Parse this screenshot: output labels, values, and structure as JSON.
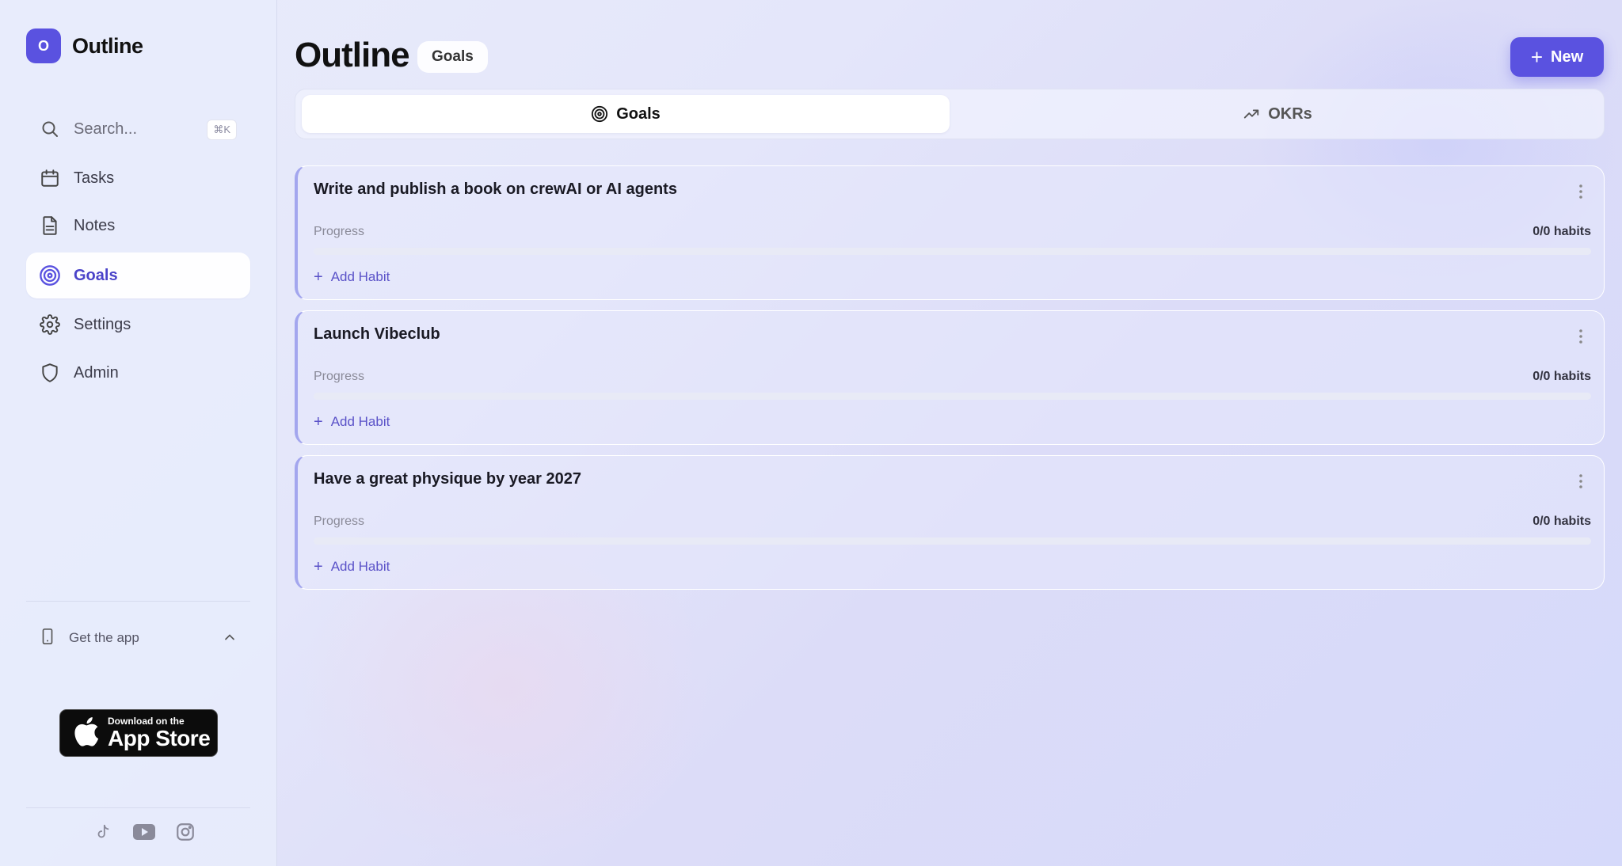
{
  "app": {
    "logo_letter": "O",
    "name": "Outline"
  },
  "sidebar": {
    "search": {
      "placeholder": "Search...",
      "shortcut": "⌘K"
    },
    "items": [
      {
        "label": "Tasks",
        "icon": "calendar-icon"
      },
      {
        "label": "Notes",
        "icon": "document-icon"
      },
      {
        "label": "Goals",
        "icon": "target-icon",
        "active": true
      },
      {
        "label": "Settings",
        "icon": "gear-icon"
      },
      {
        "label": "Admin",
        "icon": "shield-icon"
      }
    ],
    "get_app": {
      "label": "Get the app",
      "icon": "phone-icon"
    },
    "app_store": {
      "small": "Download on the",
      "big": "App Store"
    },
    "socials": [
      "tiktok-icon",
      "youtube-icon",
      "instagram-icon"
    ]
  },
  "header": {
    "title": "Outline",
    "badge": "Goals",
    "new_button": "New"
  },
  "tabs": [
    {
      "label": "Goals",
      "icon": "target-icon",
      "active": true
    },
    {
      "label": "OKRs",
      "icon": "trending-up-icon"
    }
  ],
  "goals": [
    {
      "title": "Write and publish a book on crewAI or AI agents",
      "progress_label": "Progress",
      "progress_count": "0/0 habits",
      "progress": 0,
      "add_label": "Add Habit"
    },
    {
      "title": "Launch Vibeclub",
      "progress_label": "Progress",
      "progress_count": "0/0 habits",
      "progress": 0,
      "add_label": "Add Habit"
    },
    {
      "title": "Have a great physique by year 2027",
      "progress_label": "Progress",
      "progress_count": "0/0 habits",
      "progress": 0,
      "add_label": "Add Habit"
    }
  ],
  "colors": {
    "accent": "#5a52e0",
    "active_text": "#4a43c9"
  }
}
